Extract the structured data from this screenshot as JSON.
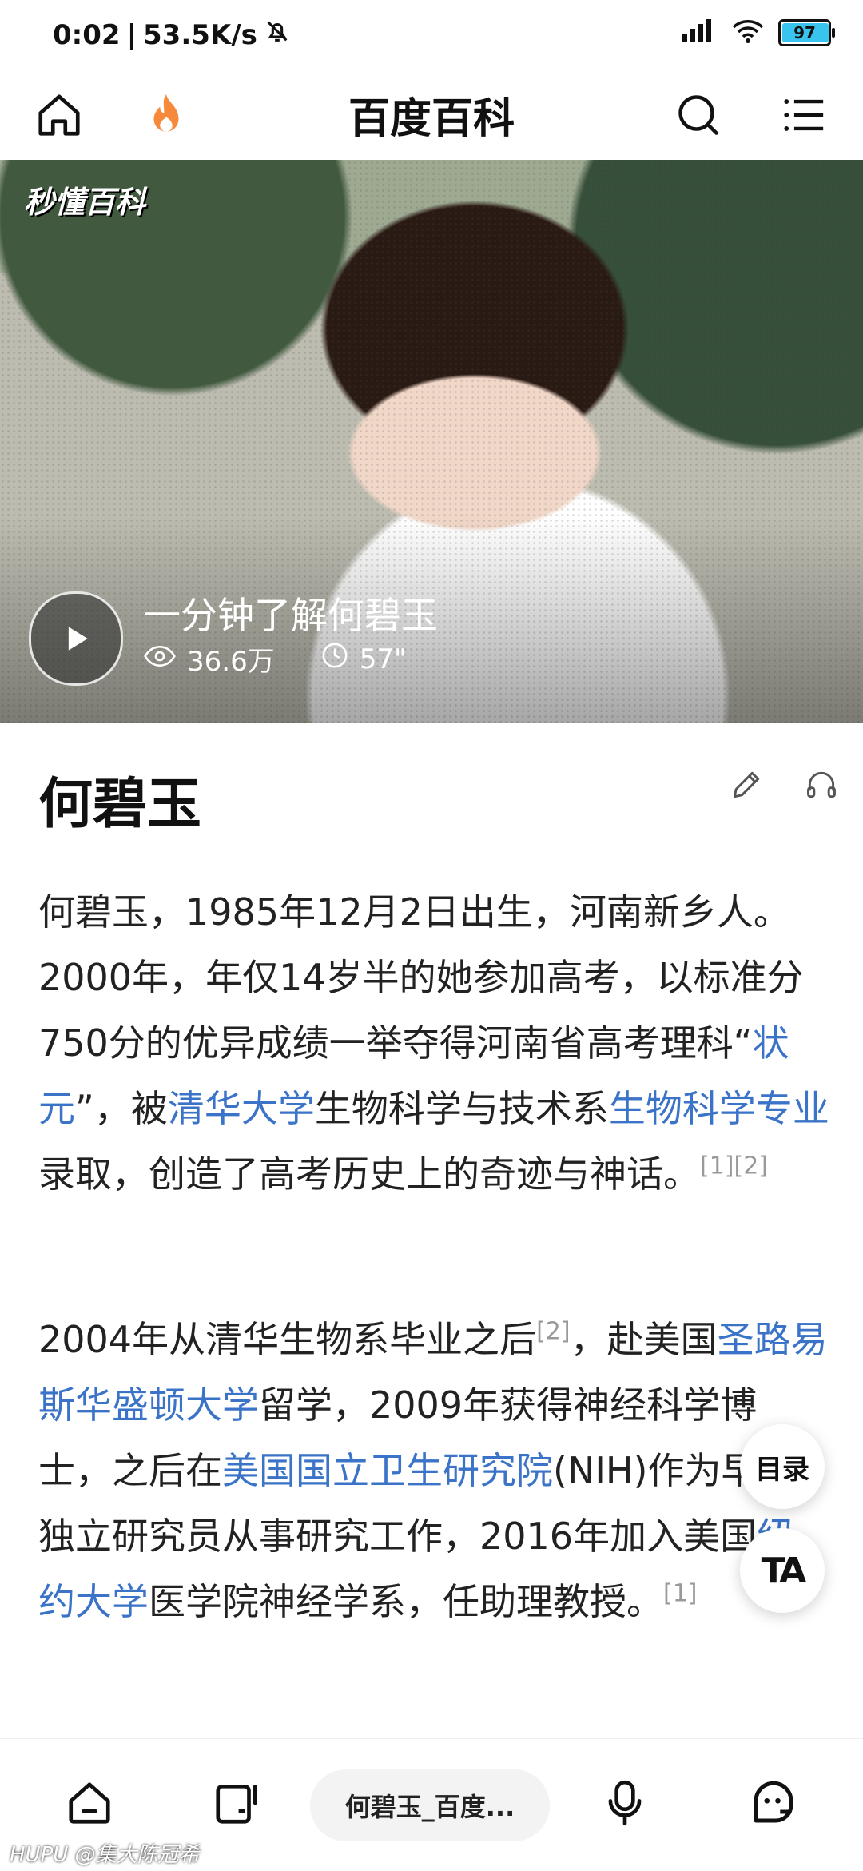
{
  "status_bar": {
    "time": "0:02",
    "net_speed": "53.5K/s",
    "battery": "97",
    "battery_level": 0.97
  },
  "top_nav": {
    "title": "百度百科"
  },
  "video": {
    "logo": "秒懂百科",
    "title": "一分钟了解何碧玉",
    "views": "36.6万",
    "duration": "57\""
  },
  "article": {
    "title": "何碧玉",
    "p1": {
      "t1": "何碧玉，1985年12月2日出生，河南新乡人。2000年，年仅14岁半的她参加高考，以标准分750分的优异成绩一举夺得河南省高考理科“",
      "l1": "状元",
      "t2": "”，被",
      "l2": "清华大学",
      "t3": "生物科学与技术系",
      "l3": "生物科学专业",
      "t4": "录取，创造了高考历史上的奇迹与神话。",
      "ref": "[1][2]"
    },
    "p2": {
      "t1": "2004年从清华生物系毕业之后",
      "ref1": "[2]",
      "t2": "，赴美国",
      "l1": "圣路易斯华盛顿大学",
      "t3": "留学，2009年获得神经科学博士，之后在",
      "l2": "美国国立卫生研究院",
      "t4": "(NIH)作为早期独立研究员从事研究工作，2016年加入美国",
      "l3": "纽约大学",
      "t5": "医学院神经学系，任助理教授。",
      "ref2": "[1]"
    }
  },
  "floating": {
    "toc_label": "目录",
    "ta_label": "TA"
  },
  "bottom_bar": {
    "tab_title": "何碧玉_百度..."
  },
  "watermark": "HUPU @集大陈冠希"
}
